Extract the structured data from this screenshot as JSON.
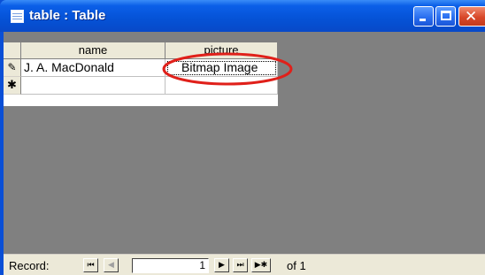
{
  "window": {
    "title": "table : Table",
    "buttons": {
      "minimize_icon": "minimize-icon",
      "maximize_icon": "maximize-icon",
      "close_icon": "close-icon"
    }
  },
  "table": {
    "columns": [
      "name",
      "picture"
    ],
    "rows": [
      {
        "selector": "edit-pencil-icon",
        "selector_glyph": "✎",
        "name": "J. A. MacDonald",
        "picture": "Bitmap Image"
      }
    ],
    "new_row_selector_glyph": "✱"
  },
  "annotation": {
    "color": "#e0201a",
    "target": "picture cell"
  },
  "navigator": {
    "label": "Record:",
    "current": "1",
    "of_text": "of 1",
    "buttons": {
      "first": "⏮",
      "prev": "◀",
      "next": "▶",
      "last": "⏭",
      "new": "▶✱"
    }
  }
}
